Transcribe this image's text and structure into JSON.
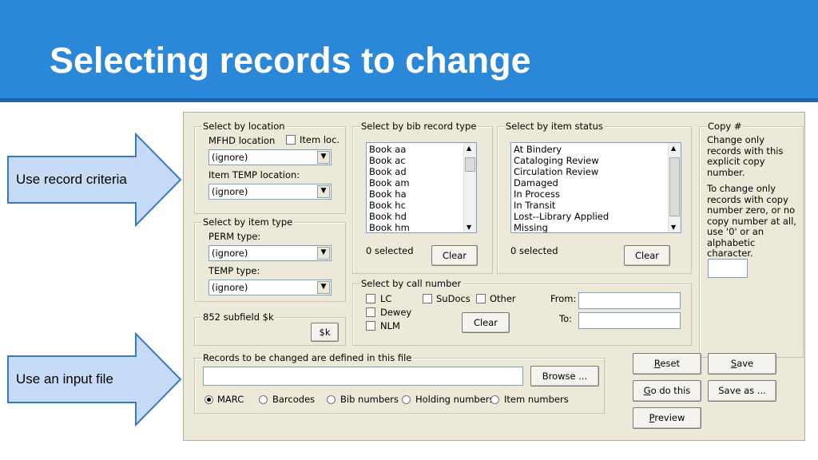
{
  "slide": {
    "title": "Selecting records to change",
    "callouts": [
      {
        "label": "Use record criteria"
      },
      {
        "label": "Use an input file"
      }
    ],
    "colors": {
      "header": "#2b87d8",
      "callout_fill": "#c6dbf7",
      "callout_border": "#3a78c8"
    }
  },
  "form": {
    "location": {
      "legend": "Select by location",
      "mfhd_label": "MFHD location",
      "item_loc_label": "Item loc.",
      "mfhd_value": "(ignore)",
      "temp_label": "Item TEMP location:",
      "temp_value": "(ignore)"
    },
    "item_type": {
      "legend": "Select by item type",
      "perm_label": "PERM type:",
      "perm_value": "(ignore)",
      "temp_label": "TEMP type:",
      "temp_value": "(ignore)"
    },
    "subfield": {
      "legend": "852 subfield $k",
      "button": "$k"
    },
    "bib_type": {
      "legend": "Select by bib record type",
      "items": [
        "Book aa",
        "Book ac",
        "Book ad",
        "Book am",
        "Book ha",
        "Book hc",
        "Book hd",
        "Book hm"
      ],
      "selected": "0 selected",
      "clear": "Clear"
    },
    "item_status": {
      "legend": "Select by item status",
      "items": [
        "At Bindery",
        "Cataloging Review",
        "Circulation Review",
        "Damaged",
        "In Process",
        "In Transit",
        "Lost--Library Applied",
        "Missing"
      ],
      "selected": "0 selected",
      "clear": "Clear"
    },
    "call_number": {
      "legend": "Select by call number",
      "lc": "LC",
      "sudocs": "SuDocs",
      "other": "Other",
      "dewey": "Dewey",
      "nlm": "NLM",
      "clear": "Clear",
      "from_label": "From:",
      "to_label": "To:"
    },
    "copy": {
      "legend": "Copy #",
      "note1": [
        "Change only",
        "records with this",
        "explicit copy",
        "number."
      ],
      "note2": [
        "To change only",
        "records with copy",
        "number zero, or no",
        "copy number at all,",
        "use '0' or  an",
        "alphabetic character."
      ]
    },
    "file": {
      "legend": "Records to be changed are defined in this file",
      "browse": "Browse ...",
      "options": [
        "MARC",
        "Barcodes",
        "Bib numbers",
        "Holding numbers",
        "Item numbers"
      ],
      "selected_option": "MARC"
    },
    "actions": {
      "reset_pre": "",
      "reset_ul": "R",
      "reset_post": "eset",
      "save_ul": "S",
      "save_post": "ave",
      "godo_ul": "G",
      "godo_post": "o do this",
      "saveas": "Save as ...",
      "preview_ul": "P",
      "preview_post": "review"
    }
  }
}
